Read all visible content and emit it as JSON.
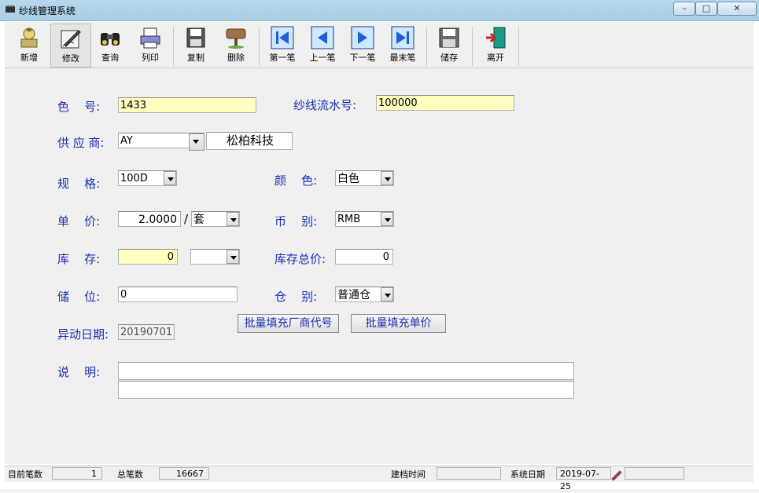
{
  "window": {
    "title": "纱线管理系统",
    "min": "–",
    "max": "□",
    "close": "✕"
  },
  "toolbar": [
    {
      "key": "new",
      "label": "新增",
      "icon": "new-record-icon"
    },
    {
      "key": "edit",
      "label": "修改",
      "icon": "edit-pen-icon"
    },
    {
      "key": "query",
      "label": "查询",
      "icon": "binoculars-icon"
    },
    {
      "key": "print",
      "label": "列印",
      "icon": "printer-icon"
    },
    {
      "key": "copy",
      "label": "复制",
      "icon": "copy-disk-icon"
    },
    {
      "key": "delete",
      "label": "删除",
      "icon": "dump-sign-icon"
    },
    {
      "key": "first",
      "label": "第一笔",
      "icon": "first-record-icon"
    },
    {
      "key": "prev",
      "label": "上一笔",
      "icon": "previous-record-icon"
    },
    {
      "key": "next",
      "label": "下一笔",
      "icon": "next-record-icon"
    },
    {
      "key": "last",
      "label": "最末笔",
      "icon": "last-record-icon"
    },
    {
      "key": "save",
      "label": "储存",
      "icon": "save-disk-icon"
    },
    {
      "key": "exit",
      "label": "离开",
      "icon": "exit-door-icon"
    }
  ],
  "form": {
    "color_no": {
      "label": "色    号:",
      "value": "1433"
    },
    "serial_no": {
      "label": "纱线流水号:",
      "value": "100000"
    },
    "supplier": {
      "label": "供 应 商:",
      "code": "AY",
      "name": "松柏科技"
    },
    "spec": {
      "label": "规    格:",
      "value": "100D"
    },
    "color": {
      "label": "颜    色:",
      "value": "白色"
    },
    "unit_price": {
      "label": "单    价:",
      "value": "2.0000",
      "slash": "/",
      "unit": "套"
    },
    "currency": {
      "label": "币    别:",
      "value": "RMB"
    },
    "stock": {
      "label": "库    存:",
      "value": "0",
      "unit": ""
    },
    "stock_total": {
      "label": "库存总价:",
      "value": "0"
    },
    "location": {
      "label": "储    位:",
      "value": "0"
    },
    "warehouse": {
      "label": "仓    别:",
      "value": "普通仓"
    },
    "change_date": {
      "label": "异动日期:",
      "value": "20190701"
    },
    "batch_vendor_btn": "批量填充厂商代号",
    "batch_price_btn": "批量填充单价",
    "note": {
      "label": "说    明:",
      "line1": "",
      "line2": ""
    }
  },
  "status": {
    "current_label": "目前笔数",
    "current_value": "1",
    "total_label": "总笔数",
    "total_value": "16667",
    "created_label": "建档时间",
    "created_value": "",
    "sysdate_label": "系统日期",
    "sysdate_value": "2019-07-25"
  }
}
